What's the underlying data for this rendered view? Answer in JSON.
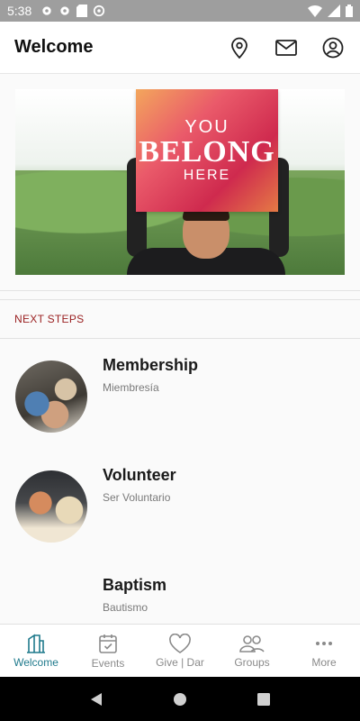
{
  "status_bar": {
    "time": "5:38"
  },
  "app_bar": {
    "title": "Welcome"
  },
  "hero": {
    "sign_line1": "YOU",
    "sign_line2": "BELONG",
    "sign_line3": "HERE"
  },
  "next_steps": {
    "title": "NEXT STEPS",
    "items": [
      {
        "title": "Membership",
        "subtitle": "Miembresía"
      },
      {
        "title": "Volunteer",
        "subtitle": "Ser Voluntario"
      },
      {
        "title": "Baptism",
        "subtitle": "Bautismo"
      }
    ]
  },
  "bottom_nav": {
    "items": [
      {
        "label": "Welcome",
        "icon": "building-icon",
        "active": true
      },
      {
        "label": "Events",
        "icon": "calendar-icon"
      },
      {
        "label": "Give | Dar",
        "icon": "heart-icon"
      },
      {
        "label": "Groups",
        "icon": "people-icon"
      },
      {
        "label": "More",
        "icon": "more-dots-icon"
      }
    ]
  },
  "colors": {
    "accent": "#1f7a8c",
    "section_title": "#9a2021",
    "status_bar": "#9e9e9e"
  }
}
